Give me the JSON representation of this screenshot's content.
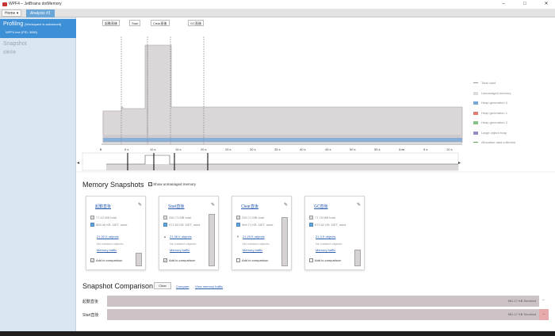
{
  "window": {
    "title": "WPF4 – JetBrains dotMemory",
    "minimize": "–",
    "maximize": "□",
    "close": "✕"
  },
  "tabs": {
    "home": "Home ▾",
    "analysis": "Analysis #1"
  },
  "sidebar": {
    "profiling": "Profiling",
    "profiling_status": "[Workspace is autosaved]",
    "process": "WPF4.exe (PID: 3660)",
    "snapshot": "Snapshot",
    "snapshot_sub": "起動直後"
  },
  "timeline": {
    "events": [
      "起動直後",
      "Start",
      "Clear直後",
      "GC直後"
    ],
    "ticks": [
      "0",
      "5 s",
      "10 s",
      "15 s",
      "20 s",
      "25 s",
      "30 s",
      "35 s",
      "40 s",
      "45 s",
      "50 s",
      "55 s",
      "1 m",
      "5 s",
      "10 s"
    ],
    "legend": [
      {
        "label": "Total used",
        "color": "#9a9a9a"
      },
      {
        "label": "Unmanaged memory",
        "color": "#dcdcdc"
      },
      {
        "label": "Heap generation 0",
        "color": "#7aa6d6"
      },
      {
        "label": "Heap generation 1",
        "color": "#e07b7b"
      },
      {
        "label": "Heap generation 2",
        "color": "#86c282"
      },
      {
        "label": "Large object heap",
        "color": "#9b85c9"
      },
      {
        "label": "Allocation data collected",
        "color": "#5aa94a"
      }
    ]
  },
  "snapshots": {
    "title": "Memory Snapshots",
    "show_unmanaged": "Show unmanaged memory",
    "cards": [
      {
        "name": "起動直後",
        "total": "77.42 MB",
        "total_label": "total",
        "net": "865.46 KB",
        "net_label": ".NET, used",
        "objects": "21.32 K objects",
        "marked": "No marked objects",
        "traffic": "Memory traffic",
        "compare": "Add to comparison",
        "checked": "✓",
        "arrow": "",
        "bar_fill": 0.25
      },
      {
        "name": "Start直後",
        "total": "250.71 MB",
        "total_label": "total",
        "net": "972.63 KB",
        "net_label": ".NET, used",
        "objects": "21.36 K objects",
        "marked": "No marked objects",
        "traffic": "Memory traffic",
        "compare": "Add to comparison",
        "checked": "✓",
        "arrow": "▲",
        "bar_fill": 1.0
      },
      {
        "name": "Clear直後",
        "total": "230.71 MB",
        "total_label": "total",
        "net": "969.71 KB",
        "net_label": ".NET, used",
        "objects": "21.29 K objects",
        "marked": "No marked objects",
        "traffic": "Memory traffic",
        "compare": "Add to comparison",
        "checked": "",
        "arrow": "▼",
        "bar_fill": 0.94
      },
      {
        "name": "GC直後",
        "total": "77.76 MB",
        "total_label": "total",
        "net": "870.62 KB",
        "net_label": ".NET, used",
        "objects": "21.3 K objects",
        "marked": "No marked objects",
        "traffic": "Memory traffic",
        "compare": "Add to comparison",
        "checked": "",
        "arrow": "",
        "bar_fill": 0.32
      }
    ]
  },
  "comparison": {
    "title": "Snapshot Comparison",
    "clear": "Clear",
    "compare": "Compare",
    "view_traffic": "View memory traffic",
    "rows": [
      {
        "label": "起動直後",
        "value": "961.17 KB Survived",
        "end": "–"
      },
      {
        "label": "Start直後",
        "value": "961.17 KB Survived",
        "end": "–"
      }
    ]
  }
}
